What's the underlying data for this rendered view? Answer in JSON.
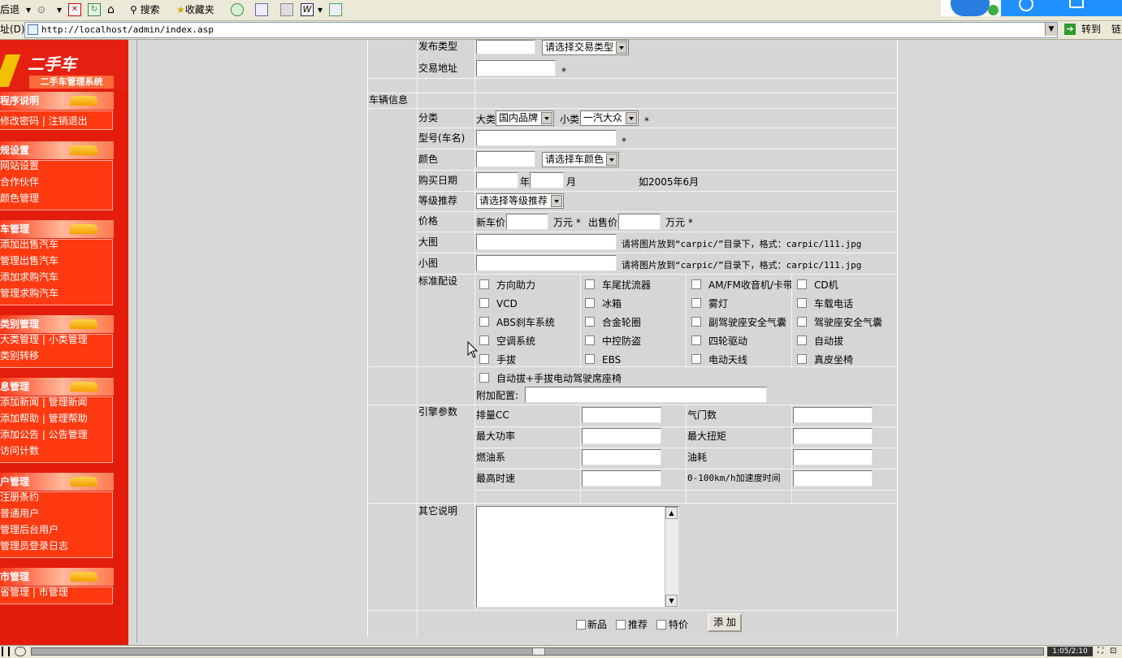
{
  "toolbar": {
    "back_label": "后退",
    "search_label": "搜索",
    "favorites_label": "收藏夹"
  },
  "address": {
    "label": "址(D)",
    "url": "http://localhost/admin/index.asp",
    "go_label": "转到",
    "links_label": "链"
  },
  "sidebar": {
    "logo_title": "二手车",
    "logo_subtitle": "二手车管理系统",
    "sections": [
      {
        "title": "程序说明",
        "items": [
          "修改密码 | 注销退出"
        ]
      },
      {
        "title": "规设置",
        "items": [
          "网站设置",
          "合作伙伴",
          "颜色管理"
        ]
      },
      {
        "title": "车管理",
        "items": [
          "添加出售汽车",
          "管理出售汽车",
          "添加求购汽车",
          "管理求购汽车"
        ]
      },
      {
        "title": "类别管理",
        "items": [
          "大类管理 | 小类管理",
          "类别转移"
        ]
      },
      {
        "title": "息管理",
        "items": [
          "添加新闻 | 管理新闻",
          "添加帮助 | 管理帮助",
          "添加公告 | 公告管理",
          "访问计数"
        ]
      },
      {
        "title": "户管理",
        "items": [
          "注册条约",
          "普通用户",
          "管理后台用户",
          "管理员登录日志"
        ]
      },
      {
        "title": "市管理",
        "items": [
          "省管理 | 市管理"
        ]
      }
    ]
  },
  "form": {
    "publish_type_label": "发布类型",
    "publish_type_select": "请选择交易类型",
    "trade_address_label": "交易地址",
    "required_mark": "*",
    "vehicle_info_label": "车辆信息",
    "category_label": "分类",
    "major_label": "大类",
    "major_select": "国内品牌",
    "minor_label": "小类",
    "minor_select": "一汽大众",
    "model_label": "型号(车名)",
    "color_label": "颜色",
    "color_select": "请选择车颜色",
    "purchase_date_label": "购买日期",
    "year_label": "年",
    "month_label": "月",
    "date_hint": "如2005年6月",
    "grade_label": "等级推荐",
    "grade_select": "请选择等级推荐",
    "price_label": "价格",
    "new_price_label": "新车价",
    "wan_label": "万元 *",
    "sale_price_label": "出售价",
    "big_image_label": "大图",
    "small_image_label": "小图",
    "image_hint": "请将图片放到“carpic/”目录下，格式：carpic/111.jpg",
    "std_config_label": "标准配设",
    "std_options": [
      "方向助力",
      "车尾扰流器",
      "AM/FM收音机/卡带",
      "CD机",
      "VCD",
      "冰箱",
      "雾灯",
      "车载电话",
      "ABS刹车系统",
      "合金轮圈",
      "副驾驶座安全气囊",
      "驾驶座安全气囊",
      "空调系统",
      "中控防盗",
      "四轮驱动",
      "自动拔",
      "手拔",
      "EBS",
      "电动天线",
      "真皮坐椅"
    ],
    "extra_option": "自动拔+手拔电动驾驶席座椅",
    "extra_config_label": "附加配置:",
    "engine_label": "引擎参数",
    "engine_fields": [
      "排量CC",
      "最大功率",
      "燃油系",
      "最高时速"
    ],
    "engine_fields_right": [
      "气门数",
      "最大扭矩",
      "油耗",
      "0-100km/h加速度时间"
    ],
    "other_label": "其它说明",
    "flag_new": "新品",
    "flag_recommend": "推荐",
    "flag_special": "特价",
    "submit_label": "添 加"
  },
  "status": {
    "time": "1:05/2:10"
  }
}
